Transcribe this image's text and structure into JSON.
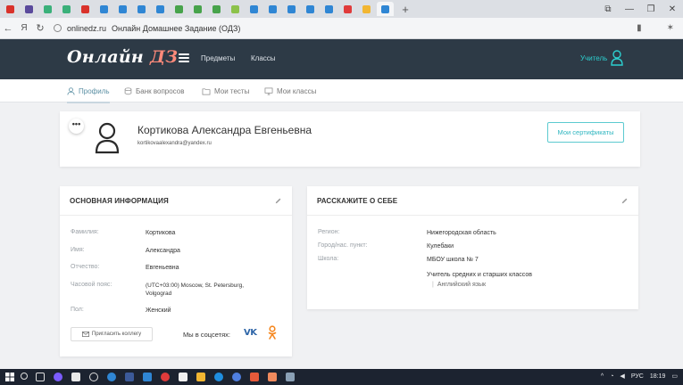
{
  "browser": {
    "tabs": [
      {
        "icon": "yandex-icon",
        "color": "#d9322b"
      },
      {
        "icon": "site-icon",
        "color": "#5a4a9c"
      },
      {
        "icon": "ok-icon",
        "color": "#3ab07a"
      },
      {
        "icon": "ok-icon",
        "color": "#3ab07a"
      },
      {
        "icon": "yandex-icon",
        "color": "#d9322b"
      },
      {
        "icon": "tab-icon",
        "color": "#2f86d4"
      },
      {
        "icon": "tab-icon",
        "color": "#2f86d4"
      },
      {
        "icon": "tab-icon",
        "color": "#2f86d4"
      },
      {
        "icon": "tab-icon",
        "color": "#2f86d4"
      },
      {
        "icon": "tab-icon",
        "color": "#47a34b"
      },
      {
        "icon": "tab-icon",
        "color": "#47a34b"
      },
      {
        "icon": "tab-icon",
        "color": "#47a34b"
      },
      {
        "icon": "tab-icon",
        "color": "#8cc24a"
      },
      {
        "icon": "tab-icon",
        "color": "#2f86d4"
      },
      {
        "icon": "tab-icon",
        "color": "#2f86d4"
      },
      {
        "icon": "tab-icon",
        "color": "#2f86d4"
      },
      {
        "icon": "tab-icon",
        "color": "#2f86d4"
      },
      {
        "icon": "tab-icon",
        "color": "#2f86d4"
      },
      {
        "icon": "tab-icon",
        "color": "#e03b3b"
      },
      {
        "icon": "tab-icon",
        "color": "#f2b632"
      },
      {
        "icon": "tab-icon",
        "color": "#2f86d4"
      }
    ],
    "url_domain": "onlinedz.ru",
    "page_title": "Онлайн Домашнее Задание (ОДЗ)"
  },
  "header": {
    "logo_main": "Онлайн",
    "logo_accent": "ДЗ",
    "nav": [
      "Предметы",
      "Классы"
    ],
    "role": "Учитель",
    "accent_color": "#2dcfcf",
    "bg_color": "#2d3a46"
  },
  "subtabs": [
    {
      "label": "Профиль",
      "icon": "user-icon"
    },
    {
      "label": "Банк вопросов",
      "icon": "database-icon"
    },
    {
      "label": "Мои тесты",
      "icon": "folder-icon"
    },
    {
      "label": "Мои классы",
      "icon": "monitor-icon"
    }
  ],
  "profile": {
    "menu_glyph": "•••",
    "name": "Кортикова Александра Евгеньевна",
    "email": "kortikovaalexandra@yandex.ru",
    "cert_button": "Мои сертификаты"
  },
  "info": {
    "title": "ОСНОВНАЯ ИНФОРМАЦИЯ",
    "rows": [
      {
        "label": "Фамилия:",
        "value": "Кортикова"
      },
      {
        "label": "Имя:",
        "value": "Александра"
      },
      {
        "label": "Отчество:",
        "value": "Евгеньевна"
      },
      {
        "label": "Часовой пояс:",
        "value": "(UTC+03:00) Moscow, St. Petersburg, Volgograd"
      },
      {
        "label": "Пол:",
        "value": "Женский"
      }
    ],
    "invite_button": "Пригласить коллегу",
    "social_label": "Мы в соцсетях:",
    "vk_text": "VK"
  },
  "about": {
    "title": "РАССКАЖИТЕ О СЕБЕ",
    "rows": [
      {
        "label": "Регион:",
        "value": "Нижегородская область"
      },
      {
        "label": "Город/нас. пункт:",
        "value": "Кулебаки"
      },
      {
        "label": "Школа:",
        "value": "МБОУ школа № 7"
      }
    ],
    "position": "Учитель средних и старших классов",
    "subject": "Английский язык"
  },
  "taskbar": {
    "lang": "РУС",
    "time": "18:19"
  }
}
